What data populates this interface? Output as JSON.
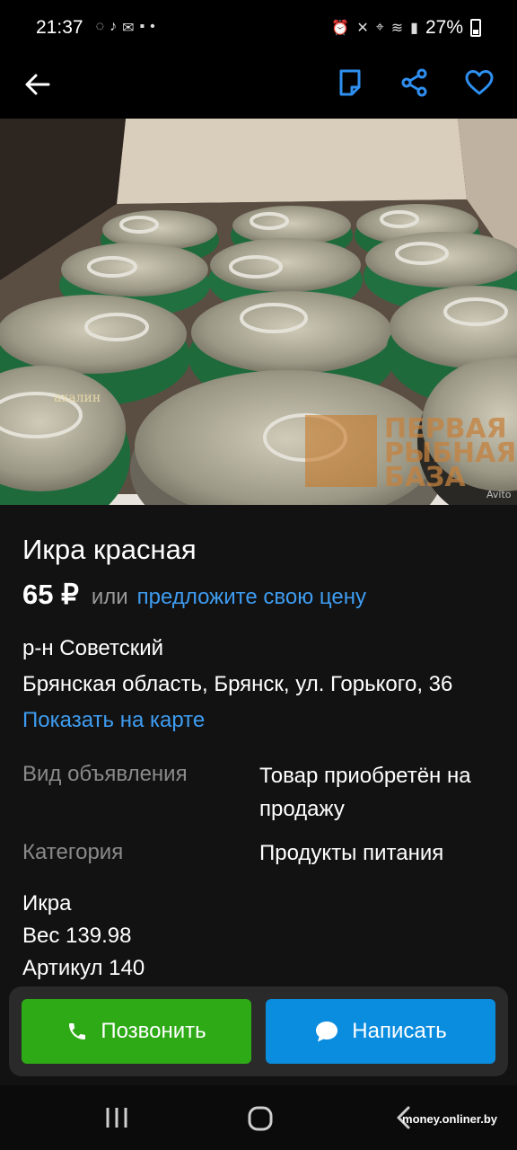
{
  "status_bar": {
    "time": "21:37",
    "battery": "27%"
  },
  "app_bar": {
    "back_icon": "arrow-left-icon",
    "actions": [
      "note-icon",
      "share-icon",
      "heart-icon"
    ]
  },
  "photo": {
    "watermark_lines": [
      "ПЕРВАЯ",
      "РЫБНАЯ",
      "БАЗА"
    ],
    "avito_tag": "Avito",
    "can_label": "ахалин"
  },
  "listing": {
    "title": "Икра красная",
    "price": "65 ₽",
    "price_or": "или",
    "price_offer": "предложите свою цену",
    "district": "р-н Советский",
    "address": "Брянская область, Брянск, ул. Горького, 36",
    "map_link": "Показать на карте"
  },
  "params": [
    {
      "label": "Вид объявления",
      "value": "Товар приобретён на продажу"
    },
    {
      "label": "Категория",
      "value": "Продукты питания"
    }
  ],
  "description": [
    "Икра",
    "Вес 139.98",
    "Артикул 140"
  ],
  "buttons": {
    "call": "Позвонить",
    "message": "Написать"
  },
  "colors": {
    "accent_blue": "#3e9cf0",
    "call_green": "#2eaa17",
    "message_blue": "#0a8ddf"
  },
  "footer_watermark": "money.onliner.by"
}
